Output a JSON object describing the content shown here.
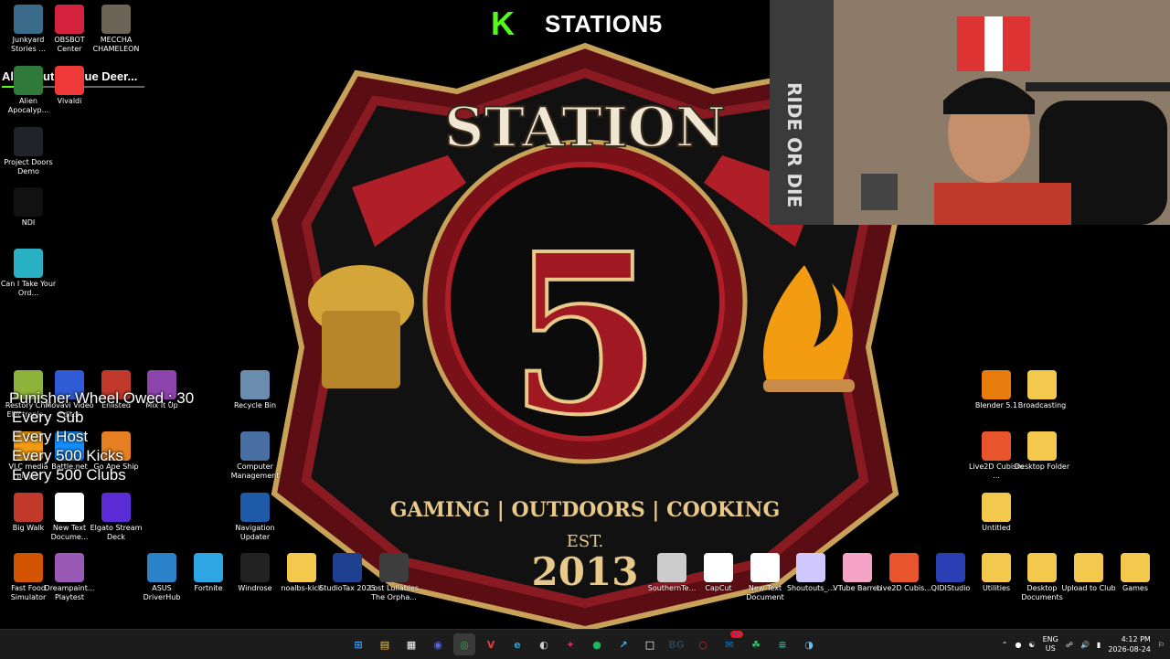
{
  "kick": {
    "k_letter": "K",
    "channel": "STATION5"
  },
  "now_playing": {
    "text": "All About — Blue Deer...",
    "progress_fraction": 0.2
  },
  "wheel": {
    "title": "Punisher Wheel Owed : 30",
    "rows": [
      "Every Sub",
      "Every Host",
      "Every 500 Kicks",
      "Every 500 Clubs"
    ]
  },
  "logo": {
    "title": "STATION",
    "number": "5",
    "tagline": "GAMING | OUTDOORS | COOKING",
    "est": "EST.",
    "year": "2013"
  },
  "webcam": {
    "banner_text": "RIDE OR DIE"
  },
  "desktop_icons": [
    {
      "label": "Junkyard Stories ...",
      "icon": "junkyard-icon",
      "color": "#3a6b8a"
    },
    {
      "label": "OBSBOT Center",
      "icon": "obsbot-icon",
      "color": "#d4213d"
    },
    {
      "label": "MECCHA CHAMELEON",
      "icon": "chameleon-icon",
      "color": "#6d6356"
    },
    {
      "label": "Alien Apocalyp...",
      "icon": "alien-icon",
      "color": "#2f7a3b"
    },
    {
      "label": "Vivaldi",
      "icon": "vivaldi-icon",
      "color": "#ef3939"
    },
    {
      "label": "Project Doors Demo",
      "icon": "doors-icon",
      "color": "#20242a"
    },
    {
      "label": "NDI",
      "icon": "ndi-icon",
      "color": "#111111"
    },
    {
      "label": "Can I Take Your Ord...",
      "icon": "can-i-take-icon",
      "color": "#2ab0c4"
    },
    {
      "label": "Restory Chill Electronic...",
      "icon": "restory-icon",
      "color": "#8fb33a"
    },
    {
      "label": "Movavi Video Editor",
      "icon": "movavi-icon",
      "color": "#2f5bd6"
    },
    {
      "label": "Enlisted",
      "icon": "enlisted-icon",
      "color": "#c0392b"
    },
    {
      "label": "Mix It Up",
      "icon": "mixitup-icon",
      "color": "#8e44ad"
    },
    {
      "label": "Recycle Bin",
      "icon": "recycle-bin-icon",
      "color": "#6a8caf"
    },
    {
      "label": "VLC media player",
      "icon": "vlc-icon",
      "color": "#f39c12"
    },
    {
      "label": "Battle.net",
      "icon": "battlenet-icon",
      "color": "#148eff"
    },
    {
      "label": "Go Ape Ship",
      "icon": "goapeship-icon",
      "color": "#e67e22"
    },
    {
      "label": "Computer Management",
      "icon": "computer-management-icon",
      "color": "#4a6fa5"
    },
    {
      "label": "Big Walk",
      "icon": "bigwalk-icon",
      "color": "#c0392b"
    },
    {
      "label": "New Text Docume...",
      "icon": "text-document-icon",
      "color": "#ffffff"
    },
    {
      "label": "Elgato Stream Deck",
      "icon": "streamdeck-icon",
      "color": "#5b2bd6"
    },
    {
      "label": "Navigation Updater",
      "icon": "navigation-updater-icon",
      "color": "#1e5aa8"
    },
    {
      "label": "Fast Food Simulator",
      "icon": "fastfood-icon",
      "color": "#d35400"
    },
    {
      "label": "Dreampaint... Playtest",
      "icon": "dreampaint-icon",
      "color": "#9b59b6"
    },
    {
      "label": "ASUS DriverHub",
      "icon": "asus-icon",
      "color": "#2c82c9"
    },
    {
      "label": "Fortnite",
      "icon": "fortnite-icon",
      "color": "#2ea6e3"
    },
    {
      "label": "Windrose",
      "icon": "windrose-icon",
      "color": "#222222"
    },
    {
      "label": "noalbs-kick",
      "icon": "folder-icon",
      "color": "#f2c94c"
    },
    {
      "label": "StudioTax 2025",
      "icon": "studiotax-icon",
      "color": "#1f3f8f"
    },
    {
      "label": "Lost Lullabies The Orpha...",
      "icon": "lostlullabies-icon",
      "color": "#3d3d3d"
    },
    {
      "label": "SouthernTe...",
      "icon": "southern-icon",
      "color": "#cccccc"
    },
    {
      "label": "CapCut",
      "icon": "capcut-icon",
      "color": "#ffffff"
    },
    {
      "label": "New Text Document",
      "icon": "text-document-icon",
      "color": "#ffffff"
    },
    {
      "label": "Shoutouts_...",
      "icon": "shoutouts-icon",
      "color": "#d0c7ff"
    },
    {
      "label": "VTube Barren",
      "icon": "vtube-icon",
      "color": "#f5a3c7"
    },
    {
      "label": "Live2D Cubis...",
      "icon": "live2d-icon",
      "color": "#e8552d"
    },
    {
      "label": "QIDIStudio",
      "icon": "qidi-icon",
      "color": "#2b3fb5"
    },
    {
      "label": "Utilities",
      "icon": "folder-icon",
      "color": "#f2c94c"
    },
    {
      "label": "Desktop Documents",
      "icon": "folder-icon",
      "color": "#f2c94c"
    },
    {
      "label": "Upload to Club",
      "icon": "folder-icon",
      "color": "#f2c94c"
    },
    {
      "label": "Games",
      "icon": "folder-icon",
      "color": "#f2c94c"
    },
    {
      "label": "Blender 5.1",
      "icon": "blender-icon",
      "color": "#e87d0d"
    },
    {
      "label": "Broadcasting",
      "icon": "folder-icon",
      "color": "#f2c94c"
    },
    {
      "label": "Live2D Cubism ...",
      "icon": "live2d-icon",
      "color": "#e8552d"
    },
    {
      "label": "Desktop Folder",
      "icon": "folder-icon",
      "color": "#f2c94c"
    },
    {
      "label": "Untitled",
      "icon": "folder-icon",
      "color": "#f2c94c"
    }
  ],
  "taskbar": {
    "icons": [
      {
        "name": "windows-start-icon",
        "glyph": "⊞",
        "color": "#3aa0ff"
      },
      {
        "name": "file-explorer-icon",
        "glyph": "▤",
        "color": "#f2c94c"
      },
      {
        "name": "store-icon",
        "glyph": "▦",
        "color": "#ffffff"
      },
      {
        "name": "discord-icon",
        "glyph": "◉",
        "color": "#5865f2"
      },
      {
        "name": "chrome-icon",
        "glyph": "◎",
        "color": "#34a853"
      },
      {
        "name": "vivaldi-icon",
        "glyph": "V",
        "color": "#ef3939"
      },
      {
        "name": "edge-icon",
        "glyph": "e",
        "color": "#2ea0d6"
      },
      {
        "name": "obs-icon",
        "glyph": "◐",
        "color": "#cccccc"
      },
      {
        "name": "app-icon",
        "glyph": "✦",
        "color": "#e0245e"
      },
      {
        "name": "spotify-icon",
        "glyph": "●",
        "color": "#1db954"
      },
      {
        "name": "elgato-icon",
        "glyph": "↗",
        "color": "#5dade2"
      },
      {
        "name": "window-icon",
        "glyph": "□",
        "color": "#ffffff"
      },
      {
        "name": "bg-icon",
        "glyph": "BG",
        "color": "#2c3e50"
      },
      {
        "name": "obsbot-icon",
        "glyph": "○",
        "color": "#d4213d"
      },
      {
        "name": "mail-icon",
        "glyph": "✉",
        "color": "#0078d4"
      },
      {
        "name": "alien-icon",
        "glyph": "☘",
        "color": "#2ecc71"
      },
      {
        "name": "audio-icon",
        "glyph": "≡",
        "color": "#1abc9c"
      },
      {
        "name": "steam-icon",
        "glyph": "◑",
        "color": "#66c0f4"
      }
    ],
    "mail_badge": "73",
    "lang_top": "ENG",
    "lang_bottom": "US",
    "time": "4:12 PM",
    "date": "2026-08-24"
  }
}
